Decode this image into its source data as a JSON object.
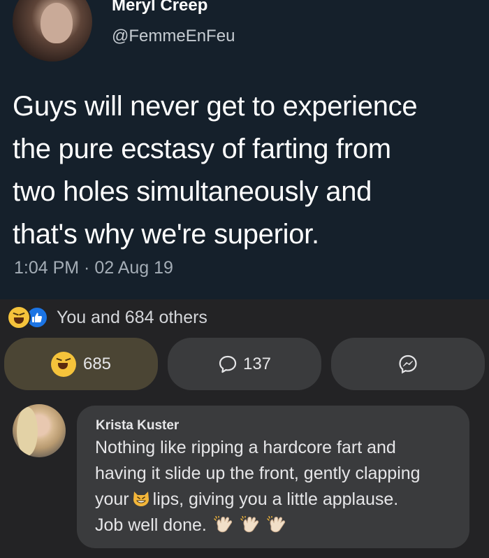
{
  "tweet": {
    "author_name": "Meryl Creep",
    "author_handle": "@FemmeEnFeu",
    "text_lines": [
      "Guys will never get to experience",
      "the pure ecstasy of farting from",
      "two holes simultaneously and",
      "that's why we're superior."
    ],
    "timestamp": "1:04 PM · 02 Aug 19"
  },
  "post": {
    "reaction_summary": "You and 684 others",
    "haha_count": "685",
    "comment_count": "137",
    "icons": {
      "haha": "haha-emoji-icon",
      "like": "like-thumb-icon",
      "comment": "comment-bubble-icon",
      "share": "messenger-icon"
    },
    "colors": {
      "like_blue": "#1b74e4",
      "haha_yellow": "#f5c33b"
    }
  },
  "comment": {
    "author": "Krista Kuster",
    "line1": "Nothing like ripping a hardcore fart and",
    "line2": "having it slide up the front, gently clapping",
    "line3_a": "your",
    "line3_b": "lips, giving you a little applause.",
    "line4": "Job well done.",
    "emojis": [
      "grinning-cat-icon",
      "clap-icon",
      "clap-icon",
      "clap-icon"
    ]
  }
}
